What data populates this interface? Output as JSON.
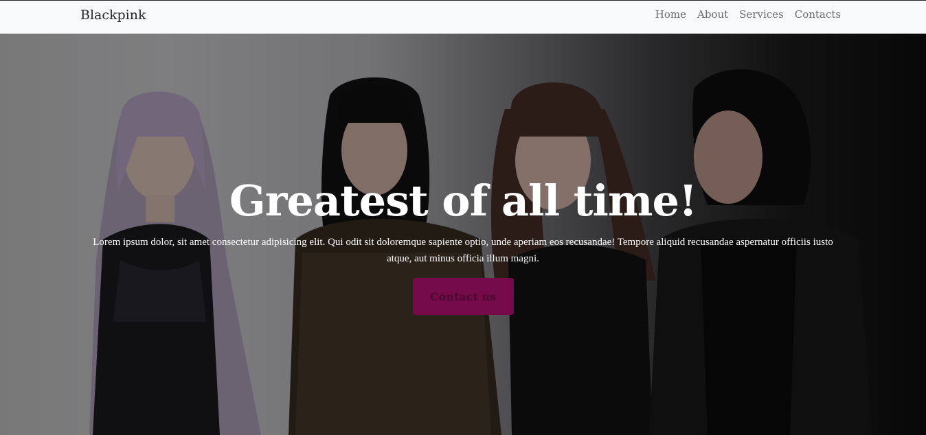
{
  "navbar": {
    "brand": "Blackpink",
    "links": [
      "Home",
      "About",
      "Services",
      "Contacts"
    ]
  },
  "hero": {
    "title": "Greatest of all time!",
    "text": "Lorem ipsum dolor, sit amet consectetur adipisicing elit. Qui odit sit doloremque sapiente optio, unde aperiam eos recusandae! Tempore aliquid recusandae aspernatur officiis iusto atque, aut minus officia illum magni.",
    "button_label": "Contact us",
    "button_color": "#750b4a"
  }
}
